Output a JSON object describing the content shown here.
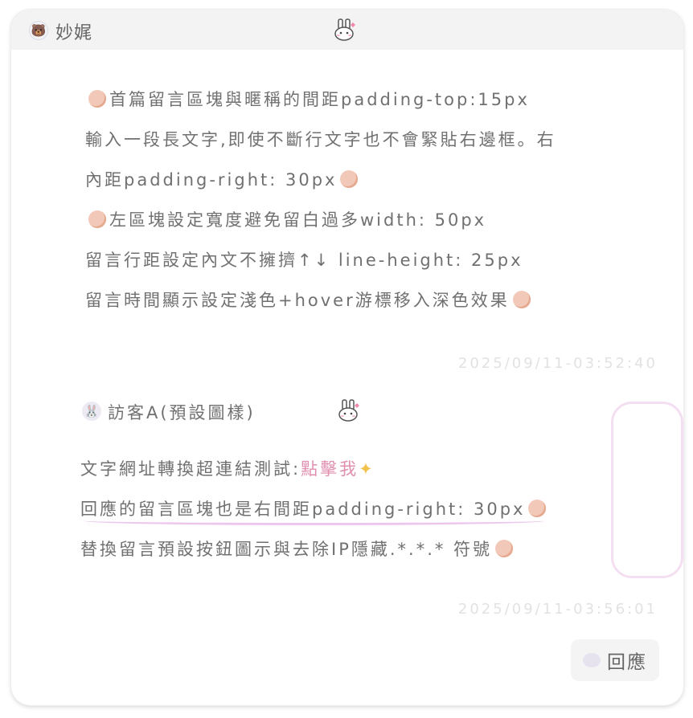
{
  "header": {
    "username": "妙娓"
  },
  "comment": {
    "lines": [
      "首篇留言區塊與暱稱的間距padding-top:15px",
      "輸入一段長文字,即使不斷行文字也不會緊貼右邊框。右",
      "內距padding-right: 30px",
      "左區塊設定寬度避免留白過多width: 50px",
      "留言行距設定內文不擁擠↑↓ line-height: 25px",
      "留言時間顯示設定淺色+hover游標移入深色效果"
    ],
    "timestamp": "2025/09/11-03:52:40"
  },
  "reply": {
    "guest_name": "訪客A(預設圖樣)",
    "line1_prefix": "文字網址轉換超連結測試:",
    "link_text": "點擊我",
    "line2": "回應的留言區塊也是右間距padding-right: 30px",
    "line3": "替換留言預設按鈕圖示與去除IP隱藏.*.*.* 符號",
    "timestamp": "2025/09/11-03:56:01"
  },
  "actions": {
    "reply_label": "回應"
  },
  "icons": {
    "head_avatar": "bear-icon",
    "guest_avatar": "bunny-icon",
    "reply_icon": "speech-bubble-icon",
    "pointer": "hand-pointer-icon",
    "sparkle": "sparkle-icon"
  },
  "colors": {
    "text": "#707070",
    "timestamp": "#e2e2e2",
    "link": "#e08fb0",
    "underline": "#ecc6ec",
    "header_bg": "#f3f3f3"
  }
}
